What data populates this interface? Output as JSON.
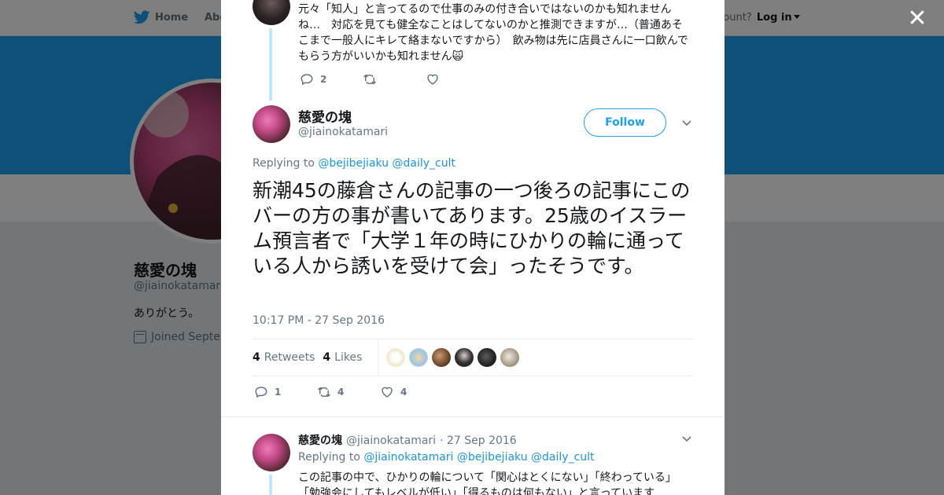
{
  "background": {
    "nav": {
      "home": "Home",
      "about": "Abo",
      "account_prompt": "ccount?",
      "login": "Log in"
    },
    "profile": {
      "name": "慈愛の塊",
      "handle": "@jiainokatamari",
      "bio": "ありがとう。",
      "joined": "Joined Septen"
    }
  },
  "close_symbol": "✕",
  "colors": {
    "accent": "#1da1f2",
    "link": "#1b95e0",
    "thread_line": "#c4e4fa",
    "muted": "#657786"
  },
  "parent_tweet": {
    "text": "元々「知人」と言ってるので仕事のみの付き合いではないのかも知れませんね…　対応を見ても健全なことはしてないのかと推測できますが…（普通あそこまで一般人にキレて絡まないですから）　飲み物は先に店員さんに一口飲んでもらう方がいいかも知れません🙀",
    "reply_count": "2",
    "retweet_count": "",
    "like_count": ""
  },
  "main_tweet": {
    "name": "慈愛の塊",
    "handle": "@jiainokatamari",
    "follow_label": "Follow",
    "replying_label": "Replying to",
    "replying_to": [
      "@bejibejiaku",
      "@daily_cult"
    ],
    "text": "新潮45の藤倉さんの記事の一つ後ろの記事にこのバーの方の事が書いてあります。25歳のイスラーム預言者で「大学１年の時にひかりの輪に通っている人から誘いを受けて会」ったそうです。",
    "timestamp": "10:17 PM - 27 Sep 2016",
    "retweets": {
      "count": "4",
      "label": "Retweets"
    },
    "likes": {
      "count": "4",
      "label": "Likes"
    },
    "likers": [
      "liker-1",
      "liker-2",
      "liker-3",
      "liker-4",
      "liker-5",
      "liker-6"
    ],
    "reply_count": "1",
    "retweet_count": "4",
    "like_count": "4"
  },
  "reply_tweet": {
    "name": "慈愛の塊",
    "handle": "@jiainokatamari",
    "date": "· 27 Sep 2016",
    "replying_label": "Replying to",
    "replying_to": [
      "@jiainokatamari",
      "@bejibejiaku",
      "@daily_cult"
    ],
    "text_line1": "この記事の中で、ひかりの輪について「関心はとくにない」「終わっている」",
    "text_line2": "「勉強会にしてもレベルが低い」「得るものは何もない」と言っています"
  }
}
